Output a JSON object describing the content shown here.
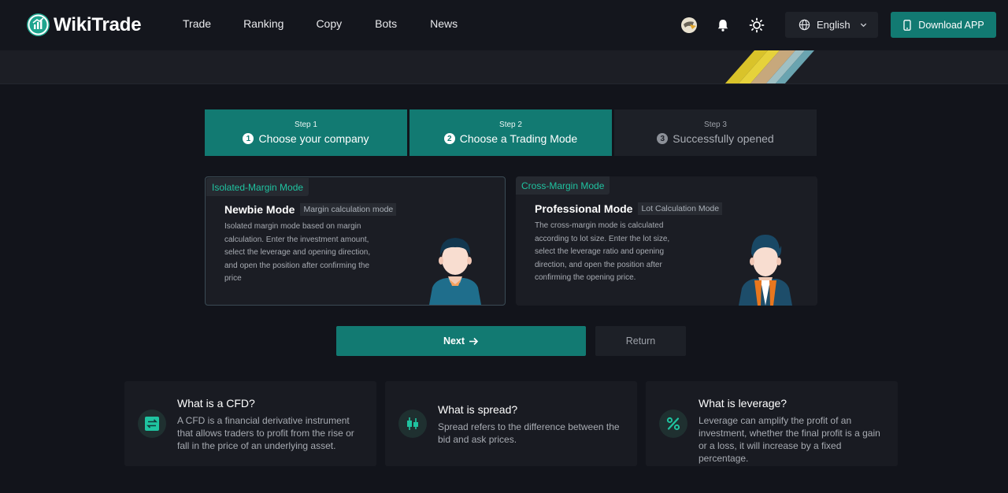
{
  "header": {
    "logo_text": "WikiTrade",
    "nav": [
      "Trade",
      "Ranking",
      "Copy",
      "Bots",
      "News"
    ],
    "language": "English",
    "download_label": "Download APP"
  },
  "steps": [
    {
      "kicker": "Step 1",
      "number": "1",
      "title": "Choose your company",
      "state": "completed"
    },
    {
      "kicker": "Step 2",
      "number": "2",
      "title": "Choose a Trading Mode",
      "state": "current"
    },
    {
      "kicker": "Step 3",
      "number": "3",
      "title": "Successfully opened",
      "state": "pending"
    }
  ],
  "modes": [
    {
      "tag": "Isolated-Margin Mode",
      "title": "Newbie Mode",
      "subtitle": "Margin calculation mode",
      "description": "Isolated margin mode based on margin calculation. Enter the investment amount, select the leverage and opening direction, and open the position after confirming the price",
      "selected": true
    },
    {
      "tag": "Cross-Margin Mode",
      "title": "Professional Mode",
      "subtitle": "Lot Calculation Mode",
      "description": "The cross-margin mode is calculated according to lot size. Enter the lot size, select the leverage ratio and opening direction, and open the position after confirming the opening price.",
      "selected": false
    }
  ],
  "actions": {
    "next_label": "Next",
    "return_label": "Return"
  },
  "faq": [
    {
      "icon": "exchange-icon",
      "title": "What is a CFD?",
      "body": "A CFD is a financial derivative instrument that allows traders to profit from the rise or fall in the price of an underlying asset."
    },
    {
      "icon": "candlestick-icon",
      "title": "What is spread?",
      "body": "Spread refers to the difference between the bid and ask prices."
    },
    {
      "icon": "percent-icon",
      "title": "What is leverage?",
      "body": "Leverage can amplify the profit of an investment, whether the final profit is a gain or a loss, it will increase by a fixed percentage."
    }
  ],
  "colors": {
    "accent": "#127a72",
    "tag_text": "#1fc3a0",
    "background": "#12141b"
  }
}
